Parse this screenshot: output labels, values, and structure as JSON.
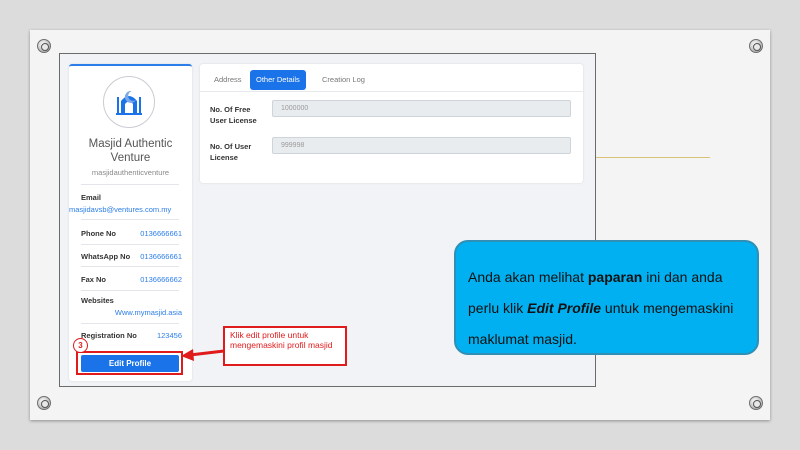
{
  "profile": {
    "name": "Masjid Authentic Venture",
    "username": "masjidauthenticventure",
    "email_label": "Email",
    "email_value": "masjidavsb@ventures.com.my",
    "phone_label": "Phone No",
    "phone_value": "0136666661",
    "whatsapp_label": "WhatsApp No",
    "whatsapp_value": "0136666661",
    "fax_label": "Fax No",
    "fax_value": "0136666662",
    "websites_label": "Websites",
    "websites_value": "Www.mymasjid.asia",
    "registration_label": "Registration No",
    "registration_value": "123456",
    "edit_button": "Edit Profile"
  },
  "tabs": [
    {
      "label": "Address",
      "active": false
    },
    {
      "label": "Other Details",
      "active": true
    },
    {
      "label": "Creation Log",
      "active": false
    }
  ],
  "details": {
    "free_license_label": "No. Of Free User License",
    "free_license_value": "1000000",
    "user_license_label": "No. Of User License",
    "user_license_value": "999998"
  },
  "annotation": {
    "step_number": "3",
    "callout_text": "Klik edit profile untuk mengemaskini profil masjid"
  },
  "instruction": {
    "part1": "Anda akan melihat ",
    "bold1": "paparan",
    "part2": " ini dan anda perlu klik ",
    "bold2": "Edit Profile",
    "part3": " untuk mengemaskini maklumat masjid."
  },
  "colors": {
    "primary_blue": "#1a73e8",
    "annotation_red": "#e01b1b",
    "bubble_cyan": "#00b0f0",
    "accent_gold": "#d9c27a"
  }
}
